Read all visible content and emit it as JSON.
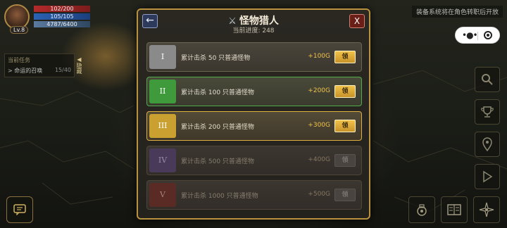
{
  "hud": {
    "level": "Lv.8",
    "hp": "102/200",
    "mp": "105/105",
    "xp": "4787/6400"
  },
  "quest": {
    "title": "当前任务",
    "item": "> 命运的召唤",
    "progress": "15/40",
    "hide_label": "隐藏"
  },
  "notice": "装备系统将在角色转职后开放",
  "modal": {
    "title": "怪物猎人",
    "title_icon": "crossed-swords-icon",
    "progress": "当前进度: 248",
    "back_label": "←",
    "close_label": "X"
  },
  "tiers": [
    {
      "numeral": "I",
      "desc": "累计击杀 50 只普通怪物",
      "reward": "+100G",
      "claim": "领",
      "color": "#8a8a8a",
      "state": "claimable"
    },
    {
      "numeral": "II",
      "desc": "累计击杀 100 只普通怪物",
      "reward": "+200G",
      "claim": "领",
      "color": "#3e9a3a",
      "state": "claimable"
    },
    {
      "numeral": "III",
      "desc": "累计击杀 200 只普通怪物",
      "reward": "+300G",
      "claim": "领",
      "color": "#caa030",
      "state": "claimable"
    },
    {
      "numeral": "IV",
      "desc": "累计击杀 500 只普通怪物",
      "reward": "+400G",
      "claim": "领",
      "color": "#4a3a5a",
      "state": "locked"
    },
    {
      "numeral": "V",
      "desc": "累计击杀 1000 只普通怪物",
      "reward": "+500G",
      "claim": "领",
      "color": "#5a2a24",
      "state": "locked"
    }
  ],
  "side_buttons": [
    "search-icon",
    "trophy-icon",
    "map-pin-icon",
    "play-icon"
  ],
  "bottom_buttons": [
    "potion-bag-icon",
    "book-icon",
    "compass-star-icon"
  ],
  "colors": {
    "modal_border": "#b8923e",
    "gold": "#f0c24a"
  }
}
